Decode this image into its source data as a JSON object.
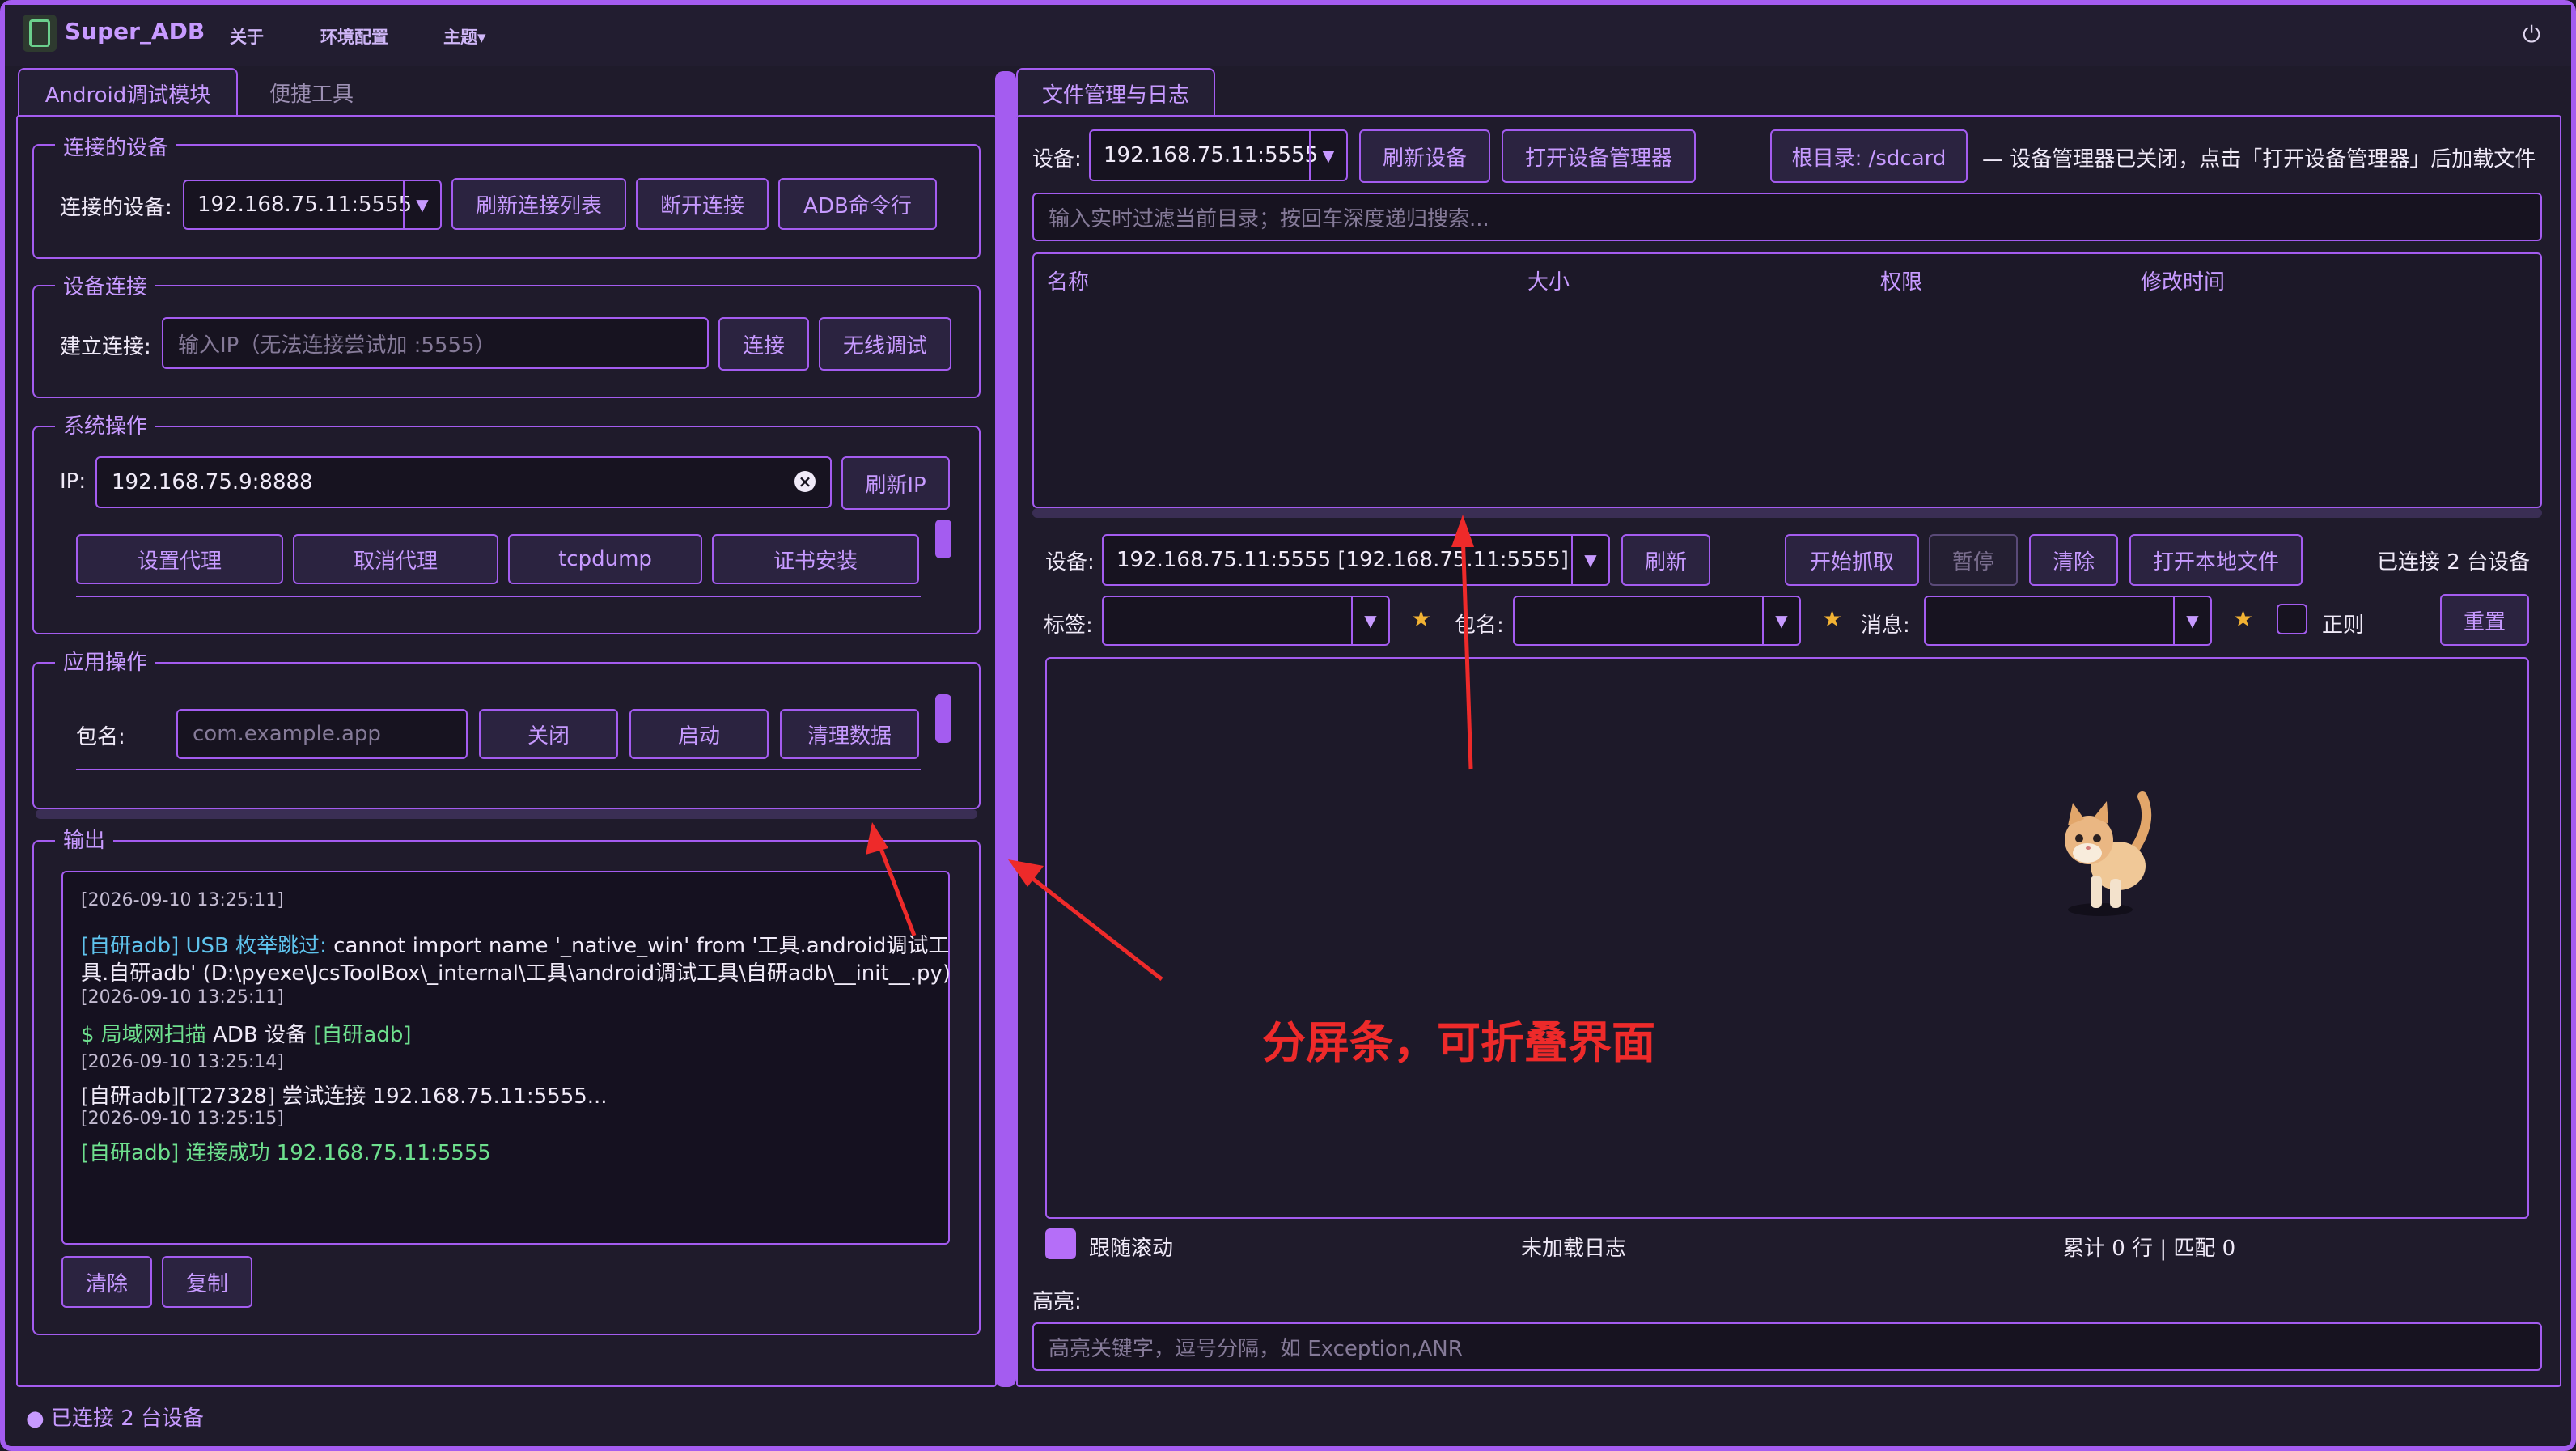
{
  "app": {
    "name": "Super_ADB",
    "menu": [
      "关于",
      "环境配置",
      "主题▾"
    ],
    "power_icon": "⏻"
  },
  "left_tabs": [
    "Android调试模块",
    "便捷工具"
  ],
  "connected": {
    "title": "连接的设备",
    "label": "连接的设备:",
    "device": "192.168.75.11:5555",
    "buttons": [
      "刷新连接列表",
      "断开连接",
      "ADB命令行"
    ]
  },
  "connect": {
    "title": "设备连接",
    "label": "建立连接:",
    "placeholder": "输入IP（无法连接尝试加 :5555）",
    "buttons": [
      "连接",
      "无线调试"
    ]
  },
  "system": {
    "title": "系统操作",
    "ip_label": "IP:",
    "ip_value": "192.168.75.9:8888",
    "refresh_ip": "刷新IP",
    "buttons": [
      "设置代理",
      "取消代理",
      "tcpdump",
      "证书安装"
    ]
  },
  "app_ops": {
    "title": "应用操作",
    "pkg_label": "包名:",
    "pkg_placeholder": "com.example.app",
    "buttons": [
      "关闭",
      "启动",
      "清理数据"
    ]
  },
  "output": {
    "title": "输出",
    "lines": [
      {
        "ts": "[2026-09-10 13:25:11]"
      },
      {
        "prefix": "[自研adb] USB 枚举跳过: ",
        "text": "cannot import name '_native_win' from '工具.android调试工"
      },
      {
        "text": "具.自研adb' (D:\\pyexe\\JcsToolBox\\_internal\\工具\\android调试工具\\自研adb\\__init__.py)"
      },
      {
        "ts": "[2026-09-10 13:25:11]"
      },
      {
        "prefix": "$ 局域网扫描 ",
        "text": "ADB 设备 ",
        "suffix": "[自研adb]"
      },
      {
        "ts": "[2026-09-10 13:25:14]"
      },
      {
        "text": "[自研adb][T27328] 尝试连接 192.168.75.11:5555..."
      },
      {
        "ts": "[2026-09-10 13:25:15]"
      },
      {
        "success": "[自研adb] 连接成功 192.168.75.11:5555"
      }
    ],
    "buttons": [
      "清除",
      "复制"
    ]
  },
  "status_bar": "● 已连接 2 台设备",
  "right_tab": "文件管理与日志",
  "files": {
    "device_label": "设备:",
    "device": "192.168.75.11:5555",
    "refresh": "刷新设备",
    "open_manager": "打开设备管理器",
    "root_dir": "根目录: /sdcard",
    "notice": "— 设备管理器已关闭，点击「打开设备管理器」后加载文件",
    "filter_placeholder": "输入实时过滤当前目录；按回车深度递归搜索...",
    "columns": [
      "名称",
      "大小",
      "权限",
      "修改时间"
    ]
  },
  "logcat": {
    "device_label": "设备:",
    "device": "192.168.75.11:5555  [192.168.75.11:5555]",
    "refresh": "刷新",
    "start": "开始抓取",
    "pause": "暂停",
    "clear": "清除",
    "open_local": "打开本地文件",
    "connected_count": "已连接 2 台设备",
    "tag_label": "标签:",
    "pkg_label": "包名:",
    "msg_label": "消息:",
    "regex": "正则",
    "reset": "重置",
    "follow": "跟随滚动",
    "status": "未加载日志",
    "stats": "累计 0 行 | 匹配 0",
    "highlight_label": "高亮:",
    "highlight_placeholder": "高亮关键字，逗号分隔，如 Exception,ANR"
  },
  "annotation": "分屏条，可折叠界面",
  "colors": {
    "accent": "#a45cf0",
    "bg": "#1f1b2b",
    "info": "#5fc4ee",
    "success": "#6ee08e",
    "arrow": "#ee2a2a"
  }
}
